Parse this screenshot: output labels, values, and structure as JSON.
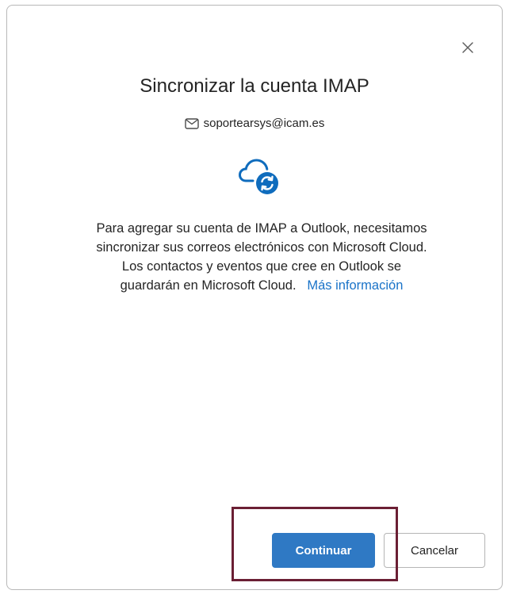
{
  "dialog": {
    "title": "Sincronizar la cuenta IMAP",
    "email": "soportearsys@icam.es",
    "body_text": "Para agregar su cuenta de IMAP a Outlook, necesitamos sincronizar sus correos electrónicos con Microsoft Cloud. Los contactos y eventos que cree en Outlook se guardarán en Microsoft Cloud.",
    "more_link": "Más información",
    "primary_button": "Continuar",
    "secondary_button": "Cancelar"
  },
  "icons": {
    "close": "close-icon",
    "mail": "mail-icon",
    "cloud_sync": "cloud-sync-icon"
  },
  "colors": {
    "accent": "#2f79c4",
    "link": "#1a73c8",
    "highlight": "#6b1f34",
    "cloud": "#0f6cbd"
  }
}
